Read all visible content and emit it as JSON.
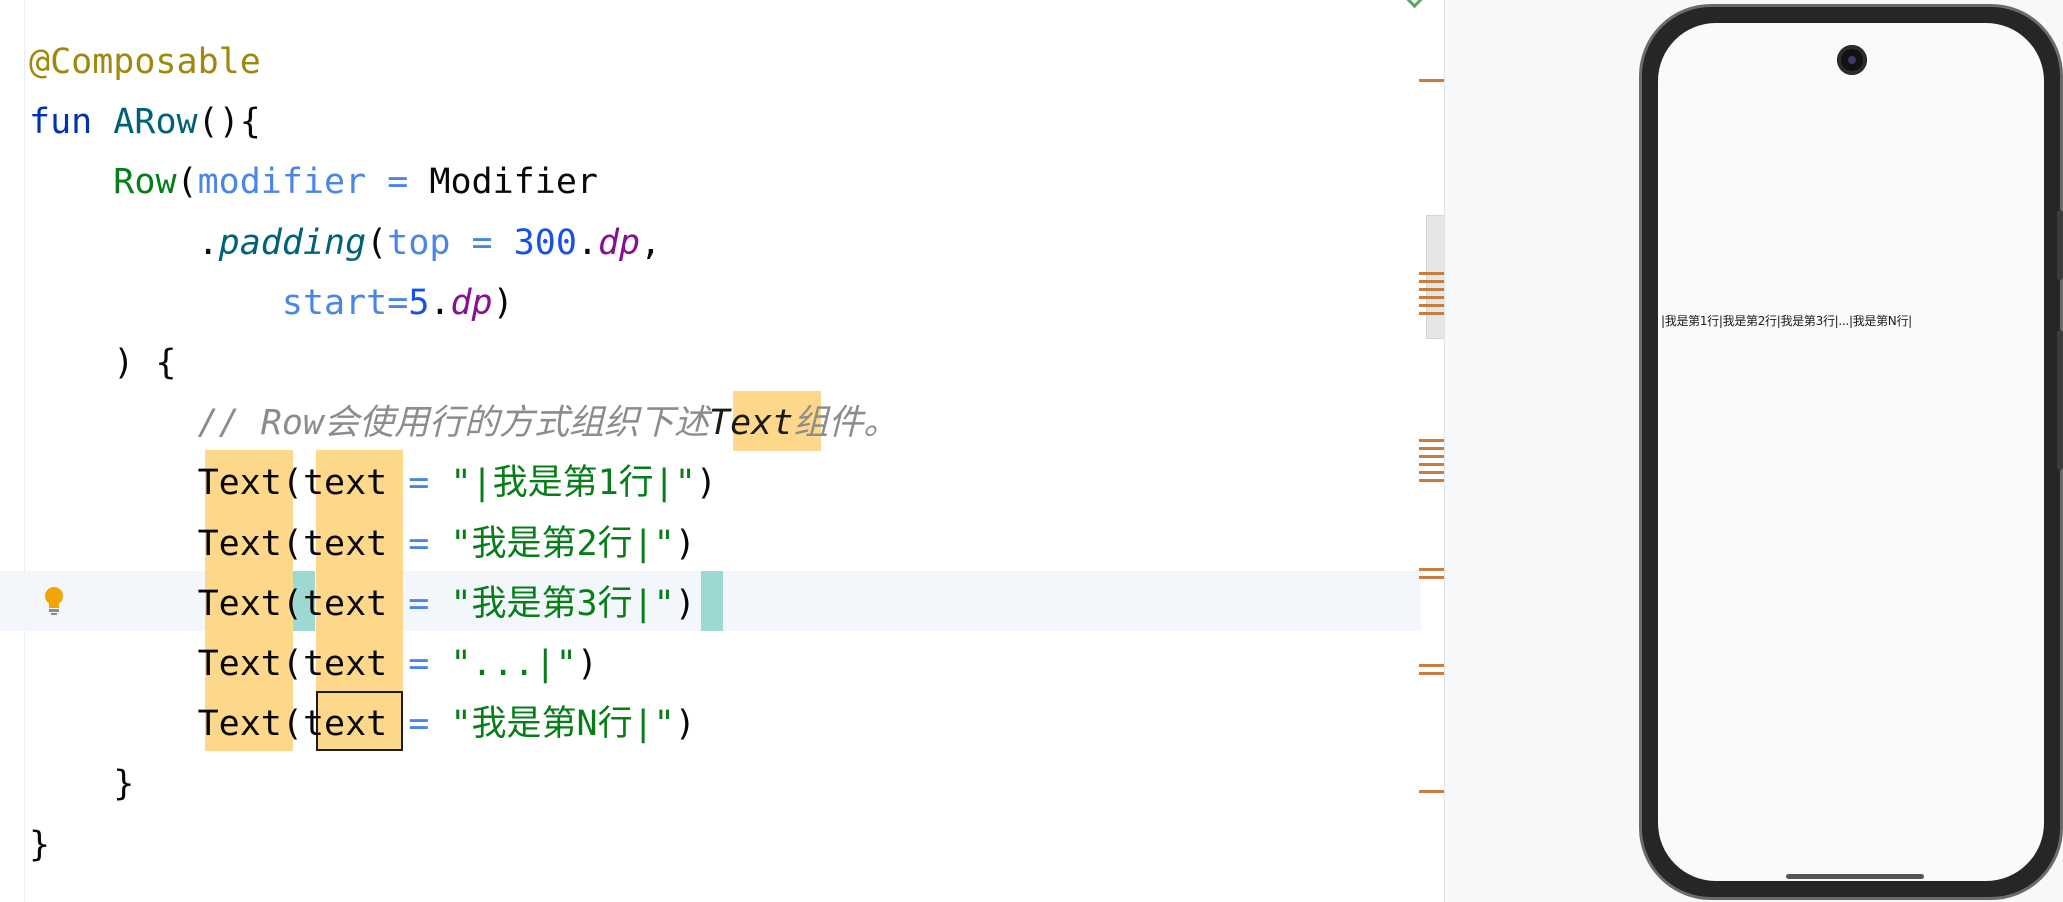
{
  "editor": {
    "lines": [
      {
        "id": "l1",
        "tokens": [
          {
            "c": "ann",
            "t": "@Composable"
          }
        ]
      },
      {
        "id": "l2",
        "tokens": [
          {
            "c": "kw",
            "t": "fun "
          },
          {
            "c": "fn",
            "t": "ARow"
          },
          {
            "c": "cls",
            "t": "(){"
          }
        ]
      },
      {
        "id": "l3",
        "tokens": [
          {
            "c": "cls",
            "t": "    "
          },
          {
            "c": "call",
            "t": "Row"
          },
          {
            "c": "cls",
            "t": "("
          },
          {
            "c": "param",
            "t": "modifier"
          },
          {
            "c": "op",
            "t": " = "
          },
          {
            "c": "cls",
            "t": "Modifier"
          }
        ]
      },
      {
        "id": "l4",
        "tokens": [
          {
            "c": "cls",
            "t": "        ."
          },
          {
            "c": "meth",
            "t": "padding"
          },
          {
            "c": "cls",
            "t": "("
          },
          {
            "c": "param",
            "t": "top"
          },
          {
            "c": "op",
            "t": " = "
          },
          {
            "c": "num",
            "t": "300"
          },
          {
            "c": "cls",
            "t": "."
          },
          {
            "c": "ext",
            "t": "dp"
          },
          {
            "c": "cls",
            "t": ","
          }
        ]
      },
      {
        "id": "l5",
        "tokens": [
          {
            "c": "cls",
            "t": "            "
          },
          {
            "c": "param",
            "t": "start"
          },
          {
            "c": "op",
            "t": "="
          },
          {
            "c": "num",
            "t": "5"
          },
          {
            "c": "cls",
            "t": "."
          },
          {
            "c": "ext",
            "t": "dp"
          },
          {
            "c": "cls",
            "t": ")"
          }
        ]
      },
      {
        "id": "l6",
        "tokens": [
          {
            "c": "cls",
            "t": "    ) {"
          }
        ]
      },
      {
        "id": "l7",
        "tokens": [
          {
            "c": "cmt",
            "t": "        // Row会使用行的方式组织下述"
          },
          {
            "c": "cmt",
            "t": "Text",
            "style": "color:#1a1a1a"
          },
          {
            "c": "cmt",
            "t": "组件。"
          }
        ]
      },
      {
        "id": "l8",
        "tokens": [
          {
            "c": "cls",
            "t": "        Text("
          },
          {
            "c": "cls",
            "t": "text"
          },
          {
            "c": "op",
            "t": " = "
          },
          {
            "c": "str",
            "t": "\"|我是第1行|\""
          },
          {
            "c": "cls",
            "t": ")"
          }
        ]
      },
      {
        "id": "l9",
        "tokens": [
          {
            "c": "cls",
            "t": "        Text("
          },
          {
            "c": "cls",
            "t": "text"
          },
          {
            "c": "op",
            "t": " = "
          },
          {
            "c": "str",
            "t": "\"我是第2行|\""
          },
          {
            "c": "cls",
            "t": ")"
          }
        ]
      },
      {
        "id": "l10",
        "tokens": [
          {
            "c": "cls",
            "t": "        Text("
          },
          {
            "c": "cls",
            "t": "text"
          },
          {
            "c": "op",
            "t": " = "
          },
          {
            "c": "str",
            "t": "\"我是第3行|\""
          },
          {
            "c": "cls",
            "t": ")"
          }
        ]
      },
      {
        "id": "l11",
        "tokens": [
          {
            "c": "cls",
            "t": "        Text("
          },
          {
            "c": "cls",
            "t": "text"
          },
          {
            "c": "op",
            "t": " = "
          },
          {
            "c": "str",
            "t": "\"...|\""
          },
          {
            "c": "cls",
            "t": ")"
          }
        ]
      },
      {
        "id": "l12",
        "tokens": [
          {
            "c": "cls",
            "t": "        Text("
          },
          {
            "c": "cls",
            "t": "text"
          },
          {
            "c": "op",
            "t": " = "
          },
          {
            "c": "str",
            "t": "\"我是第N行|\""
          },
          {
            "c": "cls",
            "t": ")"
          }
        ]
      },
      {
        "id": "l13",
        "tokens": [
          {
            "c": "cls",
            "t": "    }"
          }
        ]
      },
      {
        "id": "l14",
        "tokens": [
          {
            "c": "cls",
            "t": "}"
          }
        ]
      }
    ],
    "icons": {
      "bulb": "lightbulb-icon",
      "inspection": "check-icon"
    }
  },
  "preview": {
    "status_time": "",
    "status_icons": "",
    "row_items": [
      "|我是第1行|",
      "我是第2行|",
      "我是第3行|",
      "...|",
      "我是第N行|"
    ]
  },
  "colors": {
    "usage_highlight": "#fed88a",
    "brace_match": "#9ed8d3",
    "stripe_mark": "#c97c3d",
    "current_line": "#f3f7fc"
  }
}
